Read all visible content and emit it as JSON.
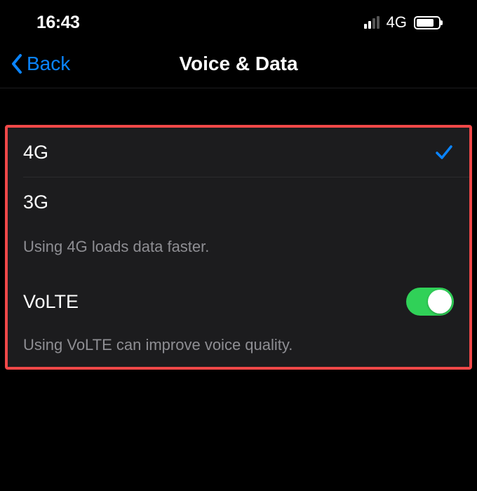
{
  "status": {
    "time": "16:43",
    "network_label": "4G"
  },
  "nav": {
    "back_label": "Back",
    "title": "Voice & Data"
  },
  "network_options": {
    "items": [
      {
        "label": "4G",
        "selected": true
      },
      {
        "label": "3G",
        "selected": false
      }
    ],
    "footer": "Using 4G loads data faster."
  },
  "volte": {
    "label": "VoLTE",
    "enabled": true,
    "footer": "Using VoLTE can improve voice quality."
  }
}
